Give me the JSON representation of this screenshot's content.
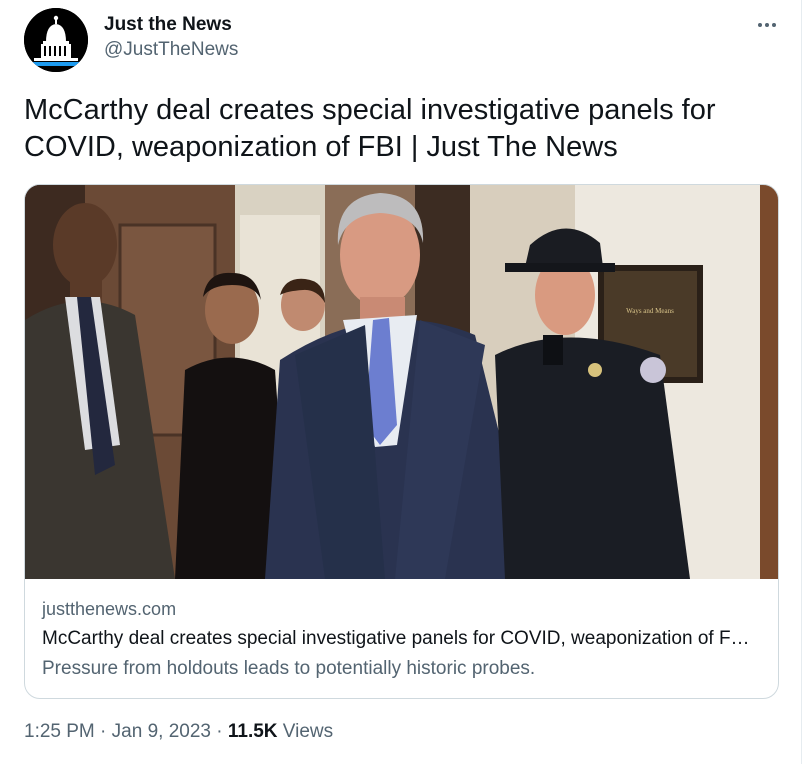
{
  "author": {
    "display_name": "Just the News",
    "handle": "@JustTheNews",
    "avatar_icon": "capitol-dome-icon"
  },
  "menu": {
    "icon": "more-options-icon"
  },
  "tweet": {
    "text": "McCarthy deal creates special investigative panels for COVID, weaponization of FBI | Just The News"
  },
  "card": {
    "image_plaque_text": "Ways and Means",
    "domain": "justthenews.com",
    "title": "McCarthy deal creates special investigative panels for COVID, weaponization of FBI | Just The News",
    "description": "Pressure from holdouts leads to potentially historic probes."
  },
  "meta": {
    "time": "1:25 PM",
    "separator1": " · ",
    "date": "Jan 9, 2023",
    "separator2": " · ",
    "views_count": "11.5K",
    "views_label": " Views"
  },
  "colors": {
    "text_primary": "#0f1419",
    "text_secondary": "#536471",
    "border": "#cfd9de"
  }
}
